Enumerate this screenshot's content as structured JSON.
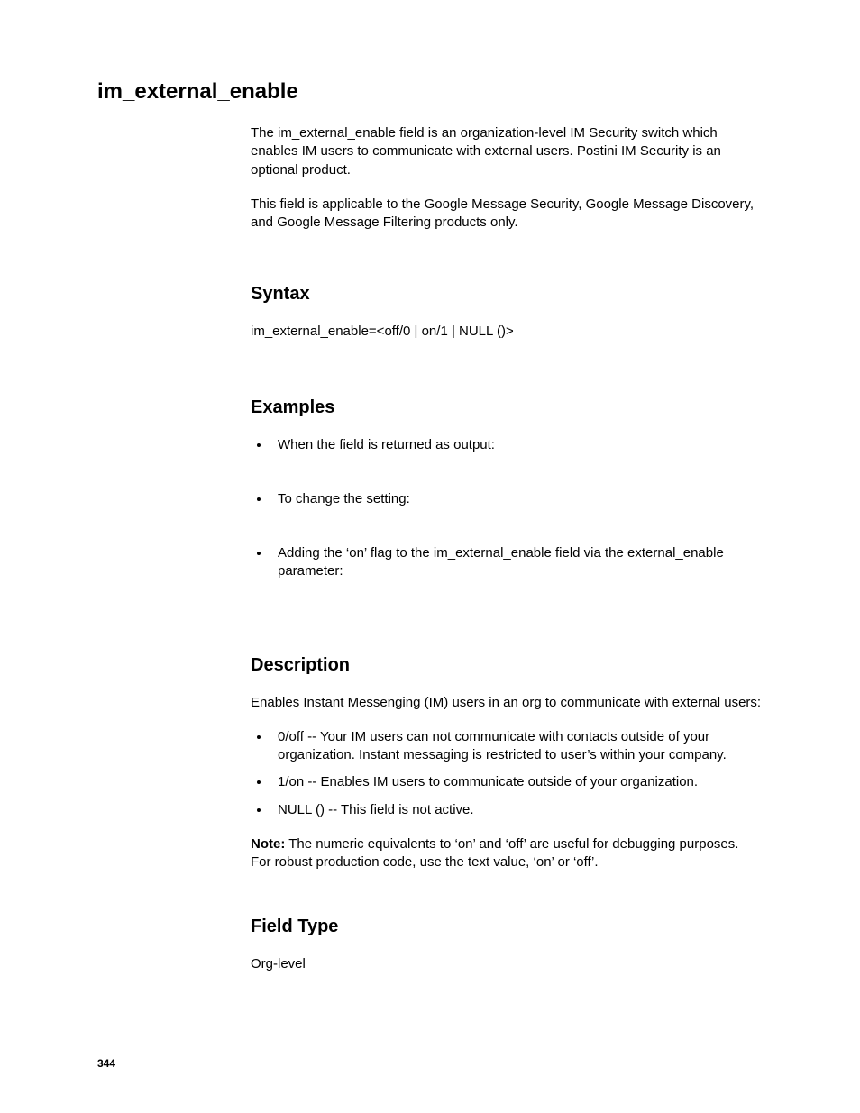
{
  "title": "im_external_enable",
  "intro": {
    "p1": "The im_external_enable field is an organization-level IM Security switch which enables IM users to communicate with external users. Postini IM Security is an optional product.",
    "p2": "This field is applicable to the Google Message Security, Google Message Discovery, and Google Message Filtering products only."
  },
  "syntax": {
    "heading": "Syntax",
    "line": "im_external_enable=<off/0 | on/1 | NULL ()>"
  },
  "examples": {
    "heading": "Examples",
    "items": [
      "When the field is returned as output:",
      "To change the setting:",
      "Adding the ‘on’ flag to the im_external_enable field via the external_enable parameter:"
    ]
  },
  "description": {
    "heading": "Description",
    "intro": "Enables Instant Messenging (IM) users in an org to communicate with external users:",
    "items": [
      "0/off -- Your IM users can not communicate with contacts outside of your organization. Instant messaging is restricted to user’s within your company.",
      "1/on -- Enables IM users to communicate outside of your organization.",
      "NULL () -- This field is not active."
    ],
    "note_label": "Note:",
    "note_text": " The numeric equivalents to ‘on’ and ‘off’ are useful for debugging purposes. For robust production code, use the text value, ‘on’ or ‘off’."
  },
  "field_type": {
    "heading": "Field Type",
    "value": "Org-level"
  },
  "page_number": "344"
}
